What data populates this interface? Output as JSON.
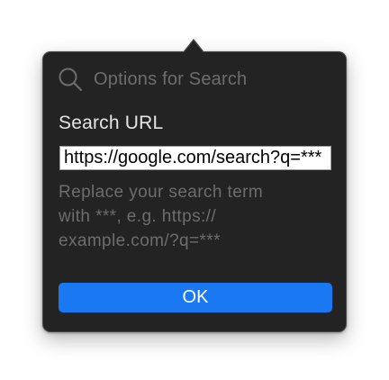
{
  "header": {
    "icon": "search-icon",
    "title": "Options for Search"
  },
  "form": {
    "section_label": "Search URL",
    "url_value": "https://google.com/search?q=***",
    "help_lines": [
      "Replace your search term",
      "with ***, e.g. https://",
      "example.com/?q=***"
    ],
    "ok_label": "OK"
  },
  "colors": {
    "panel_bg": "#232323",
    "accent": "#1a79f2",
    "muted_text": "#6d6d6d"
  }
}
